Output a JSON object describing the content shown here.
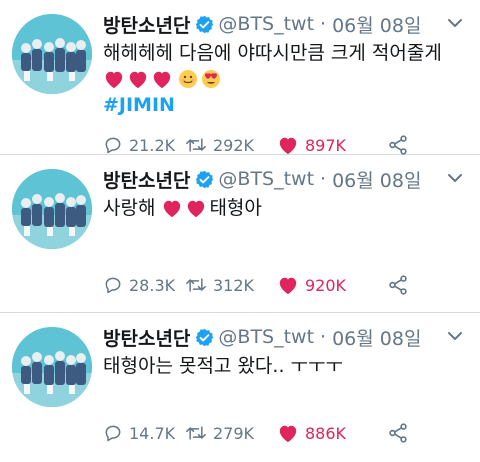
{
  "tweets": [
    {
      "author_name": "방탄소년단",
      "handle": "@BTS_twt",
      "separator": "·",
      "date": "06월 08일",
      "text_lines": [
        "해헤헤헤 다음에 야따시만큼 크게 적어줄게"
      ],
      "emoji": [
        "red-heart",
        "red-heart",
        "red-heart",
        "smiling-face",
        "heart-eyes-face"
      ],
      "hashtag": "#JIMIN",
      "stats": {
        "replies": "21.2K",
        "retweets": "292K",
        "likes": "897K"
      }
    },
    {
      "author_name": "방탄소년단",
      "handle": "@BTS_twt",
      "separator": "·",
      "date": "06월 08일",
      "text_before": "사랑해",
      "emoji": [
        "red-heart",
        "red-heart"
      ],
      "text_after": "태형아",
      "stats": {
        "replies": "28.3K",
        "retweets": "312K",
        "likes": "920K"
      }
    },
    {
      "author_name": "방탄소년단",
      "handle": "@BTS_twt",
      "separator": "·",
      "date": "06월 08일",
      "text_lines": [
        "태형아는 못적고 왔다.. ㅜㅜㅜ"
      ],
      "stats": {
        "replies": "14.7K",
        "retweets": "279K",
        "likes": "886K"
      }
    }
  ],
  "colors": {
    "accent": "#1da1f2",
    "like": "#e0245e",
    "muted": "#657786",
    "avatar_bg": "#5fc3d6"
  },
  "icons": [
    "verified-badge-icon",
    "chevron-down-icon",
    "reply-icon",
    "retweet-icon",
    "heart-icon",
    "share-icon"
  ]
}
